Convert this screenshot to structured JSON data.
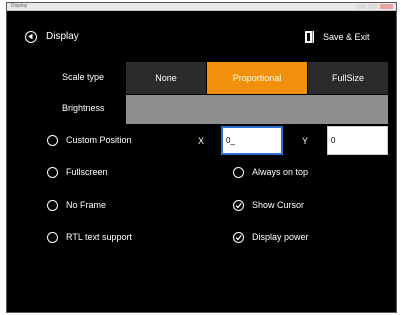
{
  "window": {
    "title": "Display"
  },
  "header": {
    "title": "Display",
    "save_label": "Save & Exit"
  },
  "scale_type": {
    "label": "Scale type",
    "options": [
      "None",
      "Proportional",
      "FullSize"
    ],
    "selected": "Proportional",
    "accent_color": "#f0900b"
  },
  "brightness": {
    "label": "Brightness"
  },
  "custom_position": {
    "label": "Custom Position",
    "checked": false,
    "x_label": "X",
    "x_value": "0_",
    "y_label": "Y",
    "y_value": "0"
  },
  "options_left": [
    {
      "label": "Fullscreen",
      "checked": false
    },
    {
      "label": "No Frame",
      "checked": false
    },
    {
      "label": "RTL text support",
      "checked": false
    }
  ],
  "options_right": [
    {
      "label": "Always on top",
      "checked": false
    },
    {
      "label": "Show Cursor",
      "checked": true
    },
    {
      "label": "Display power",
      "checked": true
    }
  ]
}
